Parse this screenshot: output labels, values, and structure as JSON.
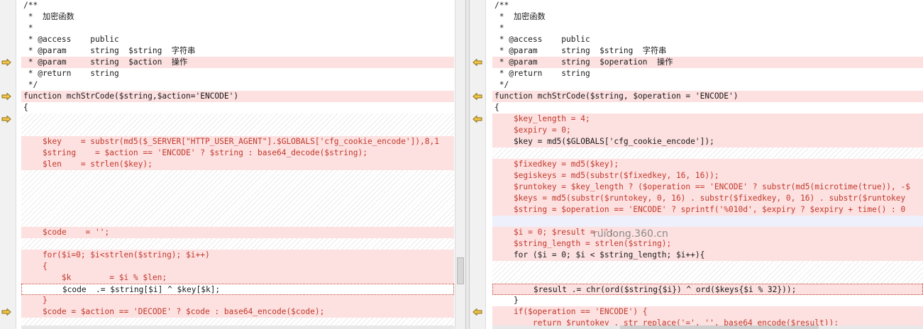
{
  "left": {
    "lines": [
      "/**",
      " *  加密函数",
      " *",
      " * @access    public",
      " * @param     string  $string  字符串",
      " * @param     string  $action  操作",
      " * @return    string",
      " */",
      "function mchStrCode($string,$action='ENCODE')",
      "{",
      "    $key    = substr(md5($_SERVER[\"HTTP_USER_AGENT\"].$GLOBALS['cfg_cookie_encode']),8,1",
      "    $string    = $action == 'ENCODE' ? $string : base64_decode($string);",
      "    $len    = strlen($key);",
      "    $code    = '';",
      "    for($i=0; $i<strlen($string); $i++)",
      "    {",
      "        $k        = $i % $len;",
      "        $code  .= $string[$i] ^ $key[$k];",
      "    }",
      "    $code = $action == 'DECODE' ? $code : base64_encode($code);"
    ]
  },
  "right": {
    "lines": [
      "/**",
      " *  加密函数",
      " *",
      " * @access    public",
      " * @param     string  $string  字符串",
      " * @param     string  $operation  操作",
      " * @return    string",
      " */",
      "function mchStrCode($string, $operation = 'ENCODE')",
      "{",
      "    $key_length = 4;",
      "    $expiry = 0;",
      "    $key = md5($GLOBALS['cfg_cookie_encode']);",
      "    $fixedkey = md5($key);",
      "    $egiskeys = md5(substr($fixedkey, 16, 16));",
      "    $runtokey = $key_length ? ($operation == 'ENCODE' ? substr(md5(microtime(true)), -$",
      "    $keys = md5(substr($runtokey, 0, 16) . substr($fixedkey, 0, 16) . substr($runtokey",
      "    $string = $operation == 'ENCODE' ? sprintf('%010d', $expiry ? $expiry + time() : 0",
      "    $i = 0; $result = '';",
      "    $string_length = strlen($string);",
      "    for ($i = 0; $i < $string_length; $i++){",
      "        $result .= chr(ord($string{$i}) ^ ord($keys{$i % 32}));",
      "    }",
      "    if($operation == 'ENCODE') {",
      "        return $runtokey . str_replace('=', '', base64_encode($result));"
    ]
  },
  "watermark": "ruidong.360.cn",
  "colors": {
    "diff_bg": "#fde0e0",
    "diff_text": "#c0392b",
    "arrow_fill": "#f3c64a",
    "arrow_stroke": "#8a6d12"
  },
  "icons": {
    "left_arrow": "arrow-right-icon",
    "right_arrow": "arrow-left-icon"
  }
}
